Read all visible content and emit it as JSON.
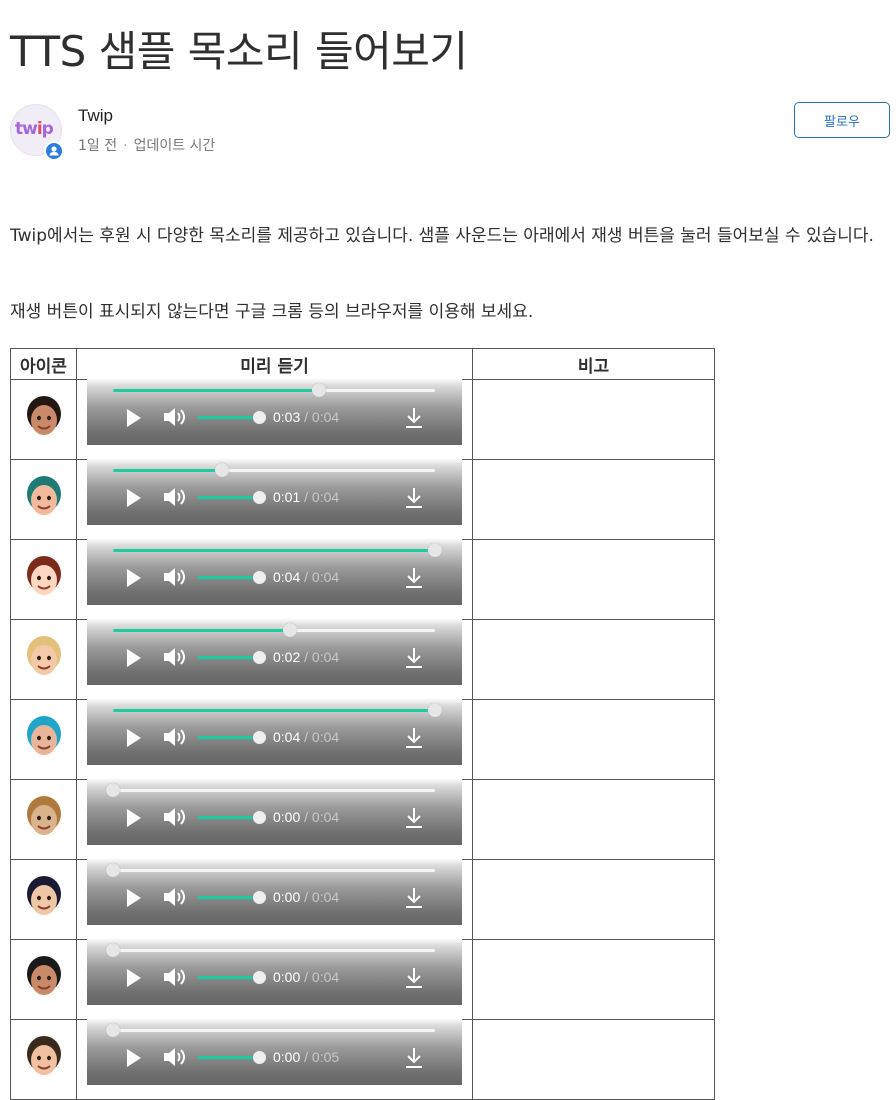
{
  "page": {
    "title": "TTS 샘플 목소리 들어보기"
  },
  "author": {
    "name": "Twip",
    "avatar_logo_a": "tw",
    "avatar_logo_b": "i",
    "avatar_logo_c": "p",
    "time_ago": "1일 전",
    "separator": "·",
    "updated_label": "업데이트 시간",
    "follow_label": "팔로우"
  },
  "body": {
    "paragraph1": "Twip에서는 후원 시 다양한 목소리를 제공하고 있습니다. 샘플 사운드는 아래에서 재생 버튼을 눌러 들어보실 수 있습니다.",
    "paragraph2": "재생 버튼이 표시되지 않는다면 구글 크롬 등의 브라우저를 이용해 보세요."
  },
  "table": {
    "headers": [
      "아이콘",
      "미리 듣기",
      "비고"
    ],
    "rows": [
      {
        "avatar": "woman-waving",
        "current": "0:03",
        "duration": "/ 0:04",
        "progress": 0.64,
        "note": ""
      },
      {
        "avatar": "teal-hair-boy",
        "current": "0:01",
        "duration": "/ 0:04",
        "progress": 0.34,
        "note": ""
      },
      {
        "avatar": "cartoon-girl",
        "current": "0:04",
        "duration": "/ 0:04",
        "progress": 1.0,
        "note": ""
      },
      {
        "avatar": "blonde-woman",
        "current": "0:02",
        "duration": "/ 0:04",
        "progress": 0.55,
        "note": ""
      },
      {
        "avatar": "blue-hair-girl",
        "current": "0:04",
        "duration": "/ 0:04",
        "progress": 1.0,
        "note": ""
      },
      {
        "avatar": "bald-man",
        "current": "0:00",
        "duration": "/ 0:04",
        "progress": 0.0,
        "note": ""
      },
      {
        "avatar": "glasses-guy",
        "current": "0:00",
        "duration": "/ 0:04",
        "progress": 0.0,
        "note": ""
      },
      {
        "avatar": "shouting-man",
        "current": "0:00",
        "duration": "/ 0:04",
        "progress": 0.0,
        "note": ""
      },
      {
        "avatar": "smiling-man",
        "current": "0:00",
        "duration": "/ 0:05",
        "progress": 0.0,
        "note": ""
      }
    ]
  },
  "colors": {
    "accent": "#1ecba0",
    "follow": "#2a6fba",
    "badge": "#2a7de1",
    "skin_tones": [
      "#c98a6a",
      "#f2b99a",
      "#ffd7c0",
      "#f4c9a8",
      "#e8b59a",
      "#d9b38c",
      "#f0c7a6",
      "#c98a6a",
      "#f0c0a0"
    ],
    "hair_colors": [
      "#231714",
      "#1f7a75",
      "#7a2b1a",
      "#e2c27a",
      "#20a5c8",
      "#b07a3e",
      "#1a1a33",
      "#1a1a1a",
      "#3a2a1c"
    ]
  }
}
